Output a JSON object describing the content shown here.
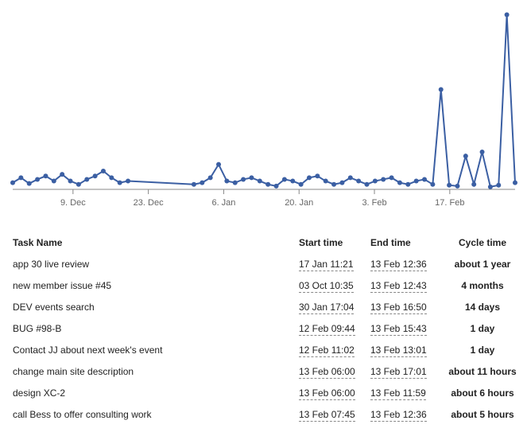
{
  "chart_data": {
    "type": "line",
    "xlabel": "",
    "ylabel": "",
    "x_ticks": [
      "9. Dec",
      "23. Dec",
      "6. Jan",
      "20. Jan",
      "3. Feb",
      "17. Feb"
    ],
    "ylim": [
      0,
      220
    ],
    "series": [
      {
        "name": "cycle_time",
        "points": [
          {
            "x": 0,
            "y": 8
          },
          {
            "x": 1,
            "y": 14
          },
          {
            "x": 2,
            "y": 7
          },
          {
            "x": 3,
            "y": 12
          },
          {
            "x": 4,
            "y": 16
          },
          {
            "x": 5,
            "y": 10
          },
          {
            "x": 6,
            "y": 18
          },
          {
            "x": 7,
            "y": 10
          },
          {
            "x": 8,
            "y": 6
          },
          {
            "x": 9,
            "y": 12
          },
          {
            "x": 10,
            "y": 16
          },
          {
            "x": 11,
            "y": 22
          },
          {
            "x": 12,
            "y": 14
          },
          {
            "x": 13,
            "y": 8
          },
          {
            "x": 14,
            "y": 10
          },
          {
            "x": 22,
            "y": 6
          },
          {
            "x": 23,
            "y": 8
          },
          {
            "x": 24,
            "y": 14
          },
          {
            "x": 25,
            "y": 30
          },
          {
            "x": 26,
            "y": 10
          },
          {
            "x": 27,
            "y": 8
          },
          {
            "x": 28,
            "y": 12
          },
          {
            "x": 29,
            "y": 14
          },
          {
            "x": 30,
            "y": 10
          },
          {
            "x": 31,
            "y": 6
          },
          {
            "x": 32,
            "y": 4
          },
          {
            "x": 33,
            "y": 12
          },
          {
            "x": 34,
            "y": 10
          },
          {
            "x": 35,
            "y": 6
          },
          {
            "x": 36,
            "y": 14
          },
          {
            "x": 37,
            "y": 16
          },
          {
            "x": 38,
            "y": 10
          },
          {
            "x": 39,
            "y": 6
          },
          {
            "x": 40,
            "y": 8
          },
          {
            "x": 41,
            "y": 14
          },
          {
            "x": 42,
            "y": 10
          },
          {
            "x": 43,
            "y": 6
          },
          {
            "x": 44,
            "y": 10
          },
          {
            "x": 45,
            "y": 12
          },
          {
            "x": 46,
            "y": 14
          },
          {
            "x": 47,
            "y": 8
          },
          {
            "x": 48,
            "y": 6
          },
          {
            "x": 49,
            "y": 10
          },
          {
            "x": 50,
            "y": 12
          },
          {
            "x": 51,
            "y": 6
          },
          {
            "x": 52,
            "y": 120
          },
          {
            "x": 53,
            "y": 5
          },
          {
            "x": 54,
            "y": 4
          },
          {
            "x": 55,
            "y": 40
          },
          {
            "x": 56,
            "y": 6
          },
          {
            "x": 57,
            "y": 45
          },
          {
            "x": 58,
            "y": 3
          },
          {
            "x": 59,
            "y": 5
          },
          {
            "x": 60,
            "y": 210
          },
          {
            "x": 61,
            "y": 8
          }
        ]
      }
    ]
  },
  "table": {
    "headers": {
      "name": "Task Name",
      "start": "Start time",
      "end": "End time",
      "cycle": "Cycle time"
    },
    "rows": [
      {
        "name": "app 30 live review",
        "start": "17 Jan 11:21",
        "end": "13 Feb 12:36",
        "cycle": "about 1 year"
      },
      {
        "name": "new member issue #45",
        "start": "03 Oct 10:35",
        "end": "13 Feb 12:43",
        "cycle": "4 months"
      },
      {
        "name": "DEV events search",
        "start": "30 Jan 17:04",
        "end": "13 Feb 16:50",
        "cycle": "14 days"
      },
      {
        "name": "BUG #98-B",
        "start": "12 Feb 09:44",
        "end": "13 Feb 15:43",
        "cycle": "1 day"
      },
      {
        "name": "Contact JJ about next week's event",
        "start": "12 Feb 11:02",
        "end": "13 Feb 13:01",
        "cycle": "1 day"
      },
      {
        "name": "change main site description",
        "start": "13 Feb 06:00",
        "end": "13 Feb 17:01",
        "cycle": "about 11 hours"
      },
      {
        "name": "design XC-2",
        "start": "13 Feb 06:00",
        "end": "13 Feb 11:59",
        "cycle": "about 6 hours"
      },
      {
        "name": "call Bess to offer consulting work",
        "start": "13 Feb 07:45",
        "end": "13 Feb 12:36",
        "cycle": "about 5 hours"
      }
    ]
  }
}
